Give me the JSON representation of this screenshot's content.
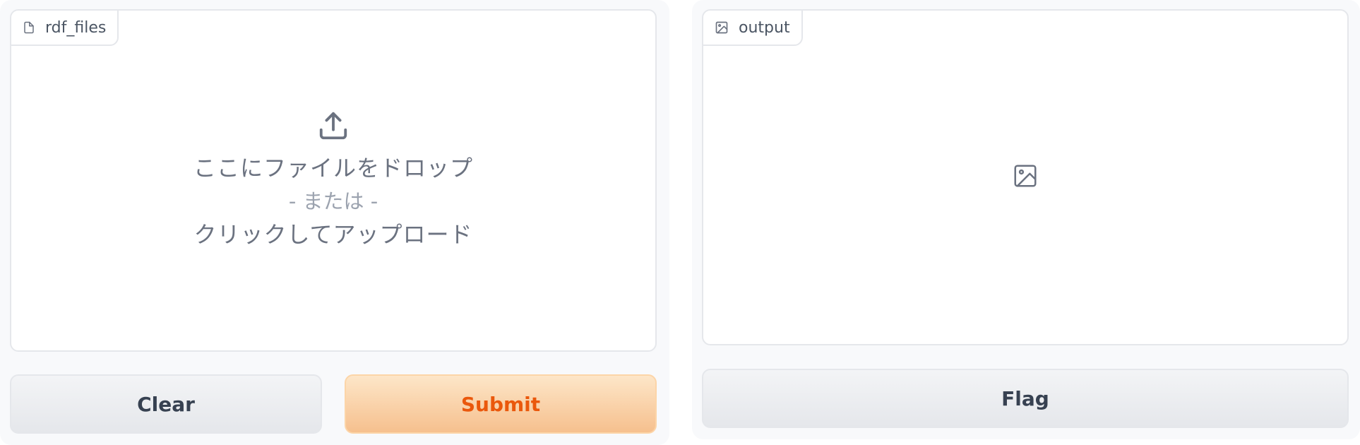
{
  "input": {
    "label": "rdf_files",
    "label_icon": "file-icon",
    "drop_text": "ここにファイルをドロップ",
    "or_text": "- または -",
    "click_text": "クリックしてアップロード",
    "upload_icon": "upload-icon"
  },
  "output": {
    "label": "output",
    "label_icon": "image-icon",
    "placeholder_icon": "image-icon"
  },
  "buttons": {
    "clear": "Clear",
    "submit": "Submit",
    "flag": "Flag"
  },
  "colors": {
    "primary_text": "#ea580c",
    "primary_bg_top": "#fde6c8",
    "primary_bg_bottom": "#f6c08e",
    "secondary_text": "#374151",
    "muted_text": "#6b7280",
    "border": "#e5e7eb"
  }
}
